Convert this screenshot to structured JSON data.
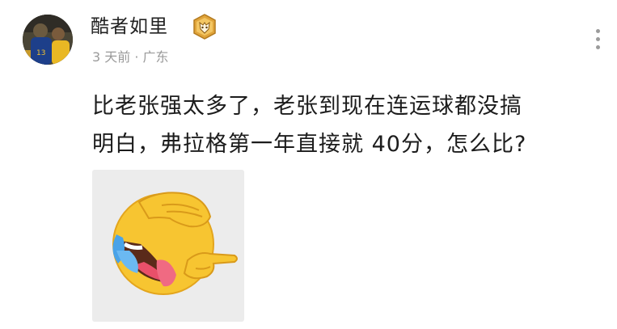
{
  "post": {
    "username": "酷者如里",
    "meta": "3 天前 · 广东",
    "content_lines": [
      "比老张强太多了，老张到现在连运球都没搞",
      "明白，弗拉格第一年直接就 40分，怎么比?"
    ],
    "icons": {
      "avatar": "user-avatar-photo",
      "badge": "gold-fox-badge-icon",
      "more": "more-vertical-icon",
      "sticker": "facepalm-laughing-crying-emoji"
    },
    "colors": {
      "text": "#1c1c1c",
      "meta": "#9a9a9a",
      "badge_gold": "#e0a43a",
      "sticker_bg": "#ececec"
    }
  }
}
